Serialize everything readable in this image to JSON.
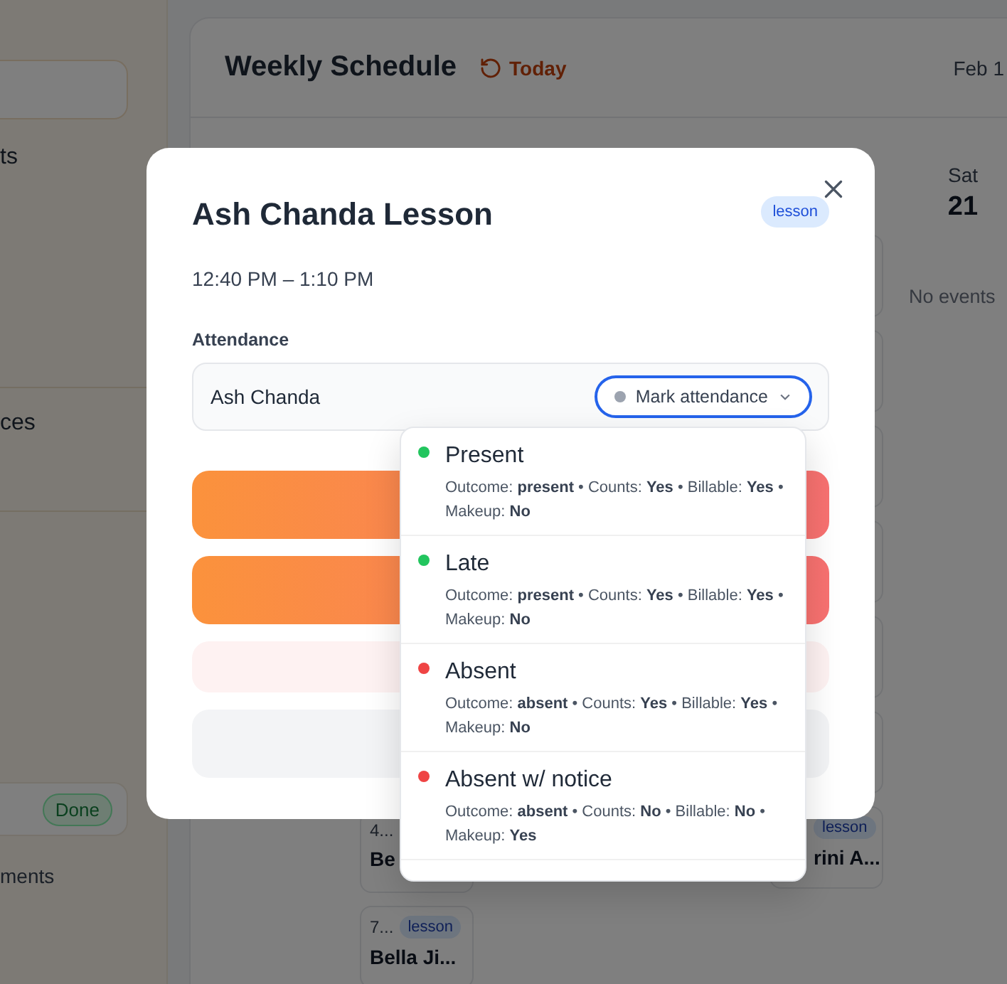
{
  "sidebar": {
    "items": [
      "ts",
      "ces"
    ],
    "status_badge": "Done",
    "footer_items": [
      "ments"
    ]
  },
  "schedule": {
    "title": "Weekly Schedule",
    "today_button": "Today",
    "date_range": "Feb 1",
    "day": {
      "name": "Sat",
      "date": "21",
      "empty_text": "No events"
    },
    "cards": [
      {
        "time": "4...",
        "title": "Be"
      },
      {
        "badge": "lesson",
        "title": "rini A..."
      },
      {
        "time": "7...",
        "badge": "lesson",
        "title": "Bella Ji..."
      }
    ]
  },
  "dialog": {
    "title": "Ash Chanda Lesson",
    "badge": "lesson",
    "time": "12:40 PM – 1:10 PM",
    "section_label": "Attendance",
    "student": "Ash Chanda",
    "attendance_button": "Mark attendance",
    "options": [
      {
        "label": "Present",
        "color": "#22c55e",
        "details": "Outcome: **present** • Counts: **Yes** • Billable: **Yes** • Makeup: **No**"
      },
      {
        "label": "Late",
        "color": "#22c55e",
        "details": "Outcome: **present** • Counts: **Yes** • Billable: **Yes** • Makeup: **No**"
      },
      {
        "label": "Absent",
        "color": "#ef4444",
        "details": "Outcome: **absent** • Counts: **Yes** • Billable: **Yes** • Makeup: **No**"
      },
      {
        "label": "Absent w/ notice",
        "color": "#ef4444",
        "details": "Outcome: **absent** • Counts: **No** • Billable: **No** • Makeup: **Yes**"
      }
    ]
  }
}
